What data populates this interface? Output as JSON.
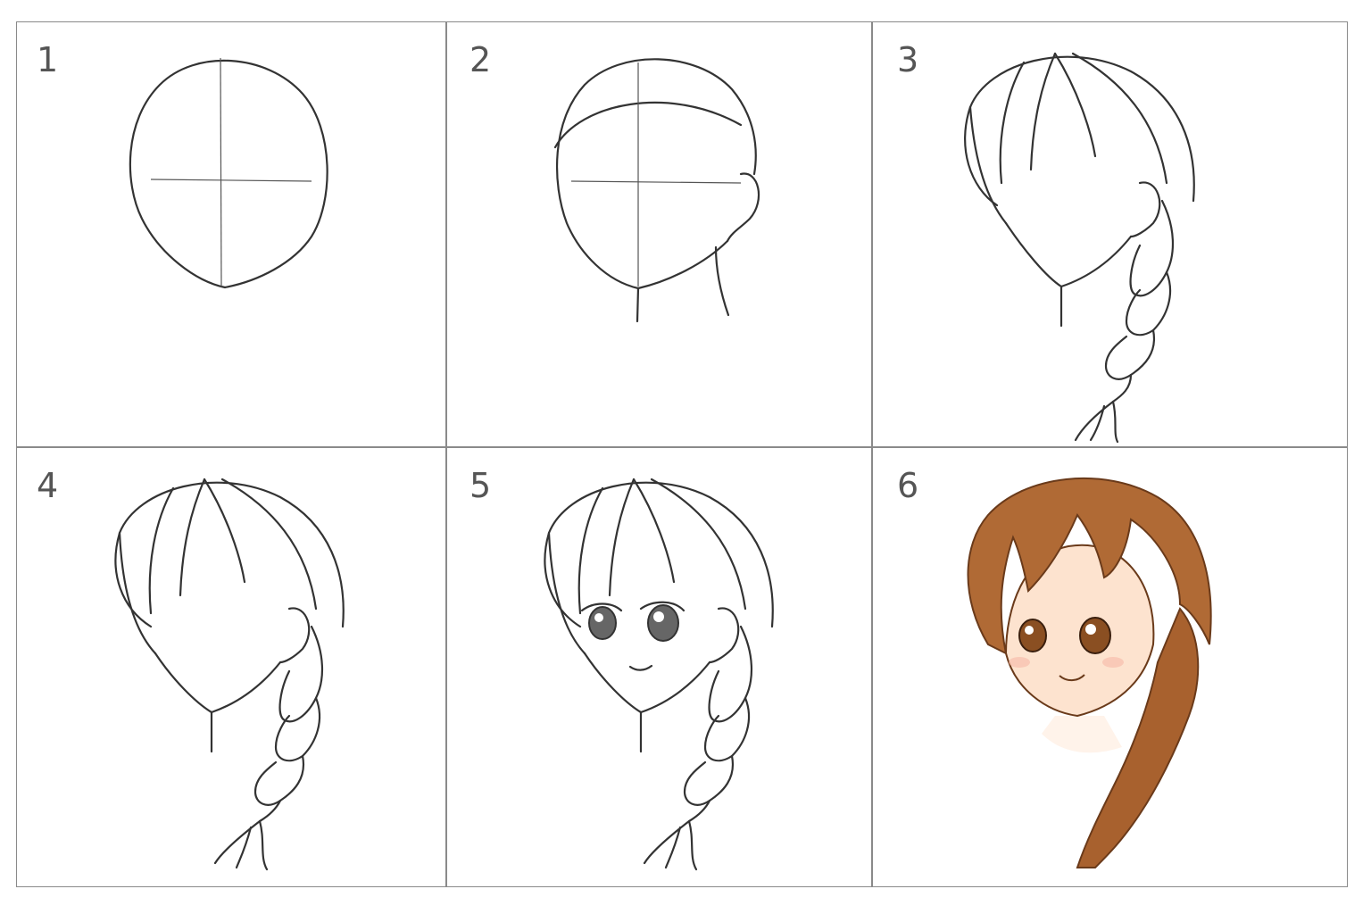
{
  "steps": [
    {
      "number": "1"
    },
    {
      "number": "2"
    },
    {
      "number": "3"
    },
    {
      "number": "4"
    },
    {
      "number": "5"
    },
    {
      "number": "6"
    }
  ],
  "colors": {
    "border": "#8a8a8a",
    "line": "#333333",
    "hair": "#b06a35",
    "hair_dark": "#7a4320",
    "skin": "#fde3cf",
    "eye": "#8a4f22"
  }
}
